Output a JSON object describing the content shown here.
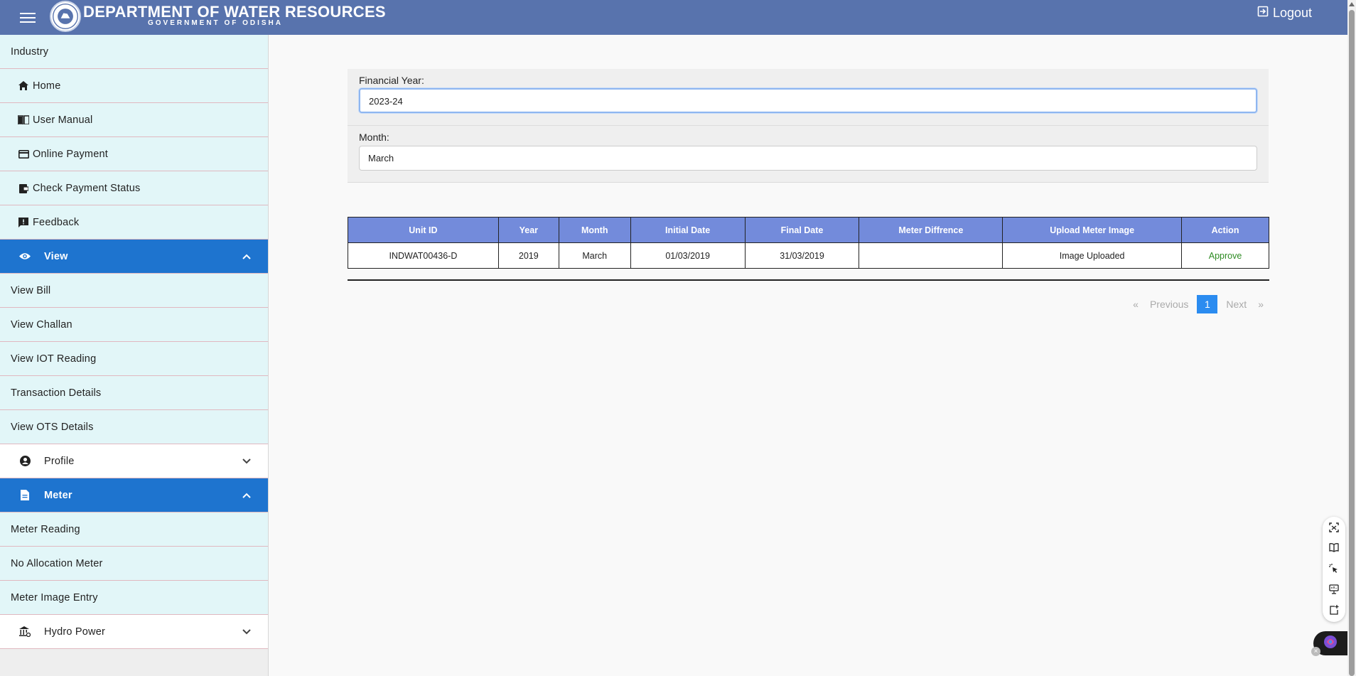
{
  "header": {
    "title": "DEPARTMENT OF WATER RESOURCES",
    "subtitle": "GOVERNMENT OF ODISHA",
    "logout_label": "Logout"
  },
  "sidebar": {
    "section_label": "Industry",
    "top_items": [
      {
        "label": "Home",
        "icon": "home-icon"
      },
      {
        "label": "User Manual",
        "icon": "book-icon"
      },
      {
        "label": "Online Payment",
        "icon": "credit-card-icon"
      },
      {
        "label": "Check Payment Status",
        "icon": "wallet-icon"
      },
      {
        "label": "Feedback",
        "icon": "feedback-icon"
      }
    ],
    "view": {
      "label": "View",
      "icon": "eye-icon",
      "expanded": true,
      "children": [
        "View Bill",
        "View Challan",
        "View IOT Reading",
        "Transaction Details",
        "View OTS Details"
      ]
    },
    "profile": {
      "label": "Profile",
      "icon": "account-circle-icon",
      "expanded": false
    },
    "meter": {
      "label": "Meter",
      "icon": "document-icon",
      "expanded": true,
      "children": [
        "Meter Reading",
        "No Allocation Meter",
        "Meter Image Entry"
      ]
    },
    "hydro": {
      "label": "Hydro Power",
      "icon": "bank-icon",
      "expanded": false
    }
  },
  "filters": {
    "financial_year_label": "Financial Year:",
    "financial_year_value": "2023-24",
    "month_label": "Month:",
    "month_value": "March"
  },
  "table": {
    "columns": [
      "Unit ID",
      "Year",
      "Month",
      "Initial Date",
      "Final Date",
      "Meter Diffrence",
      "Upload Meter Image",
      "Action"
    ],
    "rows": [
      [
        "INDWAT00436-D",
        "2019",
        "March",
        "01/03/2019",
        "31/03/2019",
        "",
        "Image Uploaded",
        "Approve"
      ]
    ]
  },
  "pagination": {
    "first": "«",
    "previous": "Previous",
    "current": "1",
    "next": "Next",
    "last": "»"
  },
  "colors": {
    "header_bg": "#5873ad",
    "sidebar_item_bg": "#e2f6f8",
    "sidebar_active_bg": "#1e74cf",
    "table_header_bg": "#738bdb",
    "approve_text": "#2e8b23",
    "pager_active_bg": "#2b8cf0"
  }
}
